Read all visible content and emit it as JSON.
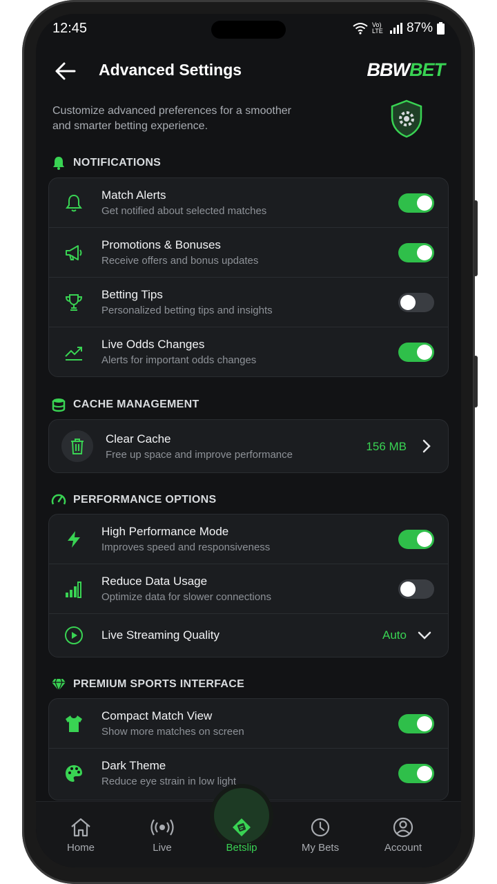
{
  "status": {
    "time": "12:45",
    "network": "Vo) LTE",
    "battery": "87%"
  },
  "header": {
    "title": "Advanced Settings",
    "brand_white": "BBW",
    "brand_green": "BET"
  },
  "intro": "Customize advanced preferences for a smoother and smarter betting experience.",
  "notifications": {
    "title": "NOTIFICATIONS",
    "items": [
      {
        "label": "Match Alerts",
        "sub": "Get notified about selected matches",
        "on": true
      },
      {
        "label": "Promotions & Bonuses",
        "sub": "Receive offers and bonus updates",
        "on": true
      },
      {
        "label": "Betting Tips",
        "sub": "Personalized betting tips and insights",
        "on": false
      },
      {
        "label": "Live Odds Changes",
        "sub": "Alerts for important odds changes",
        "on": true
      }
    ]
  },
  "cache": {
    "title": "CACHE MANAGEMENT",
    "label": "Clear Cache",
    "sub": "Free up space and improve performance",
    "size": "156 MB"
  },
  "performance": {
    "title": "PERFORMANCE OPTIONS",
    "items": [
      {
        "label": "High Performance Mode",
        "sub": "Improves speed and responsiveness",
        "on": true
      },
      {
        "label": "Reduce Data Usage",
        "sub": "Optimize data for slower connections",
        "on": false
      }
    ],
    "streaming": {
      "label": "Live Streaming Quality",
      "value": "Auto"
    }
  },
  "premium": {
    "title": "PREMIUM SPORTS INTERFACE",
    "items": [
      {
        "label": "Compact Match View",
        "sub": "Show more matches on screen",
        "on": true
      },
      {
        "label": "Dark Theme",
        "sub": "Reduce eye strain in low light",
        "on": true
      }
    ]
  },
  "nav": {
    "home": "Home",
    "live": "Live",
    "betslip": "Betslip",
    "mybets": "My Bets",
    "account": "Account"
  },
  "colors": {
    "accent": "#39d353",
    "background": "#121315",
    "card": "#1b1d20"
  }
}
